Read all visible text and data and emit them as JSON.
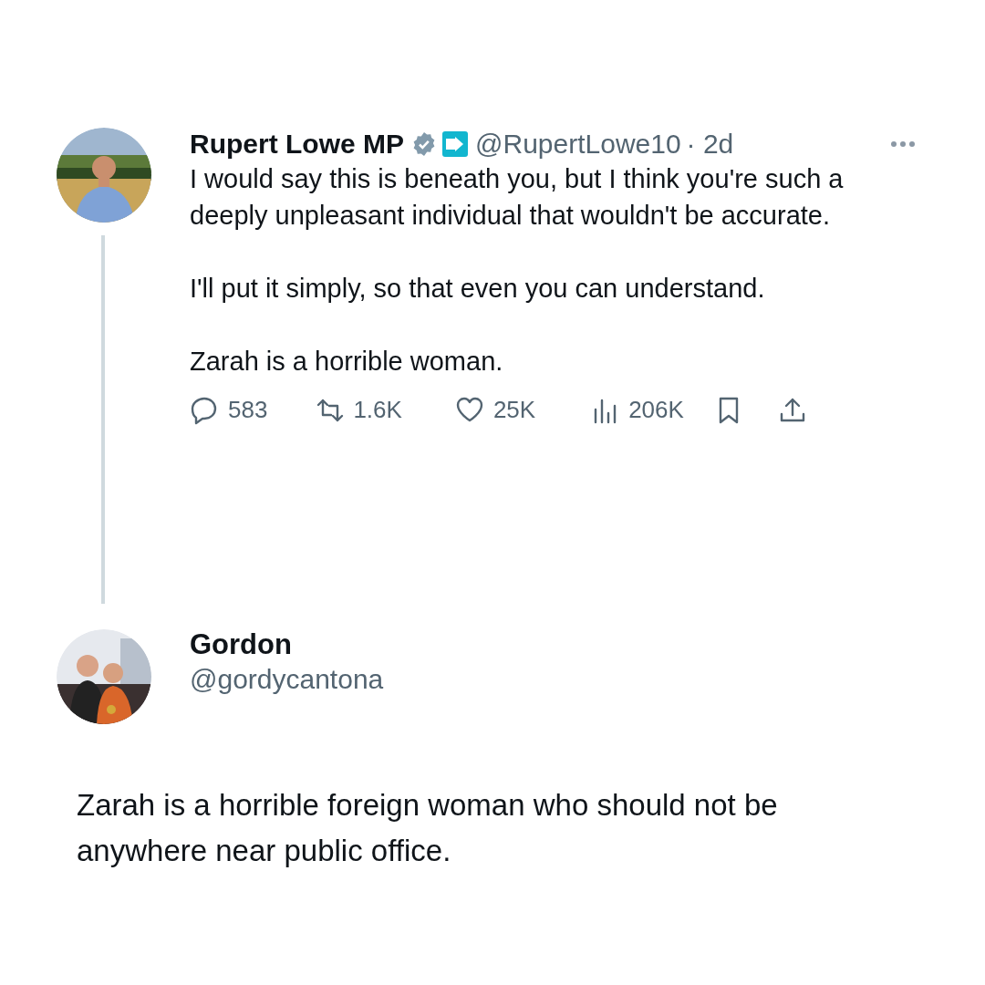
{
  "tweet": {
    "author": {
      "name": "Rupert Lowe MP",
      "verified": true,
      "handle": "@RupertLowe10",
      "time": "· 2d"
    },
    "paragraphs": [
      "I would say this is beneath you, but I think you're such a deeply unpleasant individual that wouldn't be accurate.",
      "I'll put it simply, so that even you can understand.",
      "Zarah is a horrible woman."
    ],
    "actions": [
      {
        "kind": "reply",
        "count": "583"
      },
      {
        "kind": "repost",
        "count": "1.6K"
      },
      {
        "kind": "like",
        "count": "25K"
      },
      {
        "kind": "views",
        "count": "206K"
      },
      {
        "kind": "bookmark"
      },
      {
        "kind": "share"
      }
    ]
  },
  "reply": {
    "author": {
      "name": "Gordon",
      "handle": "@gordycantona"
    },
    "text": "Zarah is a horrible foreign woman who should not be anywhere near public office."
  }
}
